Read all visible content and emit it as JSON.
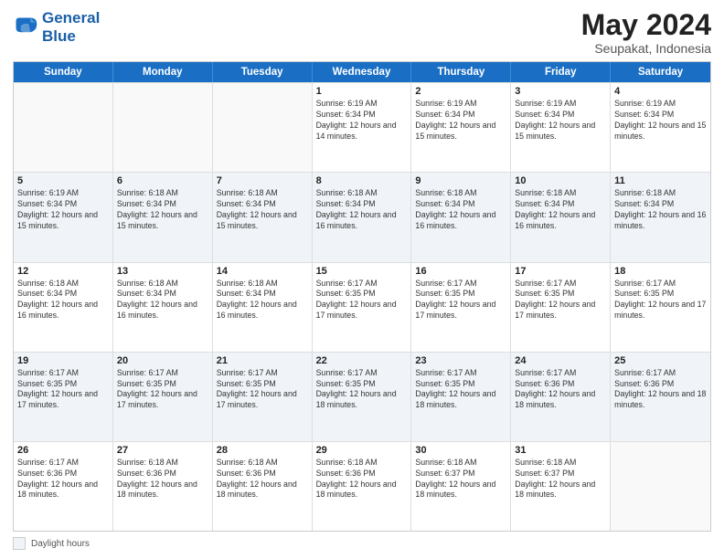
{
  "logo": {
    "line1": "General",
    "line2": "Blue"
  },
  "title": "May 2024",
  "subtitle": "Seupakat, Indonesia",
  "header_days": [
    "Sunday",
    "Monday",
    "Tuesday",
    "Wednesday",
    "Thursday",
    "Friday",
    "Saturday"
  ],
  "footer": {
    "swatch_label": "Daylight hours"
  },
  "rows": [
    [
      {
        "day": "",
        "sunrise": "",
        "sunset": "",
        "daylight": "",
        "empty": true
      },
      {
        "day": "",
        "sunrise": "",
        "sunset": "",
        "daylight": "",
        "empty": true
      },
      {
        "day": "",
        "sunrise": "",
        "sunset": "",
        "daylight": "",
        "empty": true
      },
      {
        "day": "1",
        "sunrise": "Sunrise: 6:19 AM",
        "sunset": "Sunset: 6:34 PM",
        "daylight": "Daylight: 12 hours and 14 minutes.",
        "empty": false
      },
      {
        "day": "2",
        "sunrise": "Sunrise: 6:19 AM",
        "sunset": "Sunset: 6:34 PM",
        "daylight": "Daylight: 12 hours and 15 minutes.",
        "empty": false
      },
      {
        "day": "3",
        "sunrise": "Sunrise: 6:19 AM",
        "sunset": "Sunset: 6:34 PM",
        "daylight": "Daylight: 12 hours and 15 minutes.",
        "empty": false
      },
      {
        "day": "4",
        "sunrise": "Sunrise: 6:19 AM",
        "sunset": "Sunset: 6:34 PM",
        "daylight": "Daylight: 12 hours and 15 minutes.",
        "empty": false
      }
    ],
    [
      {
        "day": "5",
        "sunrise": "Sunrise: 6:19 AM",
        "sunset": "Sunset: 6:34 PM",
        "daylight": "Daylight: 12 hours and 15 minutes.",
        "empty": false
      },
      {
        "day": "6",
        "sunrise": "Sunrise: 6:18 AM",
        "sunset": "Sunset: 6:34 PM",
        "daylight": "Daylight: 12 hours and 15 minutes.",
        "empty": false
      },
      {
        "day": "7",
        "sunrise": "Sunrise: 6:18 AM",
        "sunset": "Sunset: 6:34 PM",
        "daylight": "Daylight: 12 hours and 15 minutes.",
        "empty": false
      },
      {
        "day": "8",
        "sunrise": "Sunrise: 6:18 AM",
        "sunset": "Sunset: 6:34 PM",
        "daylight": "Daylight: 12 hours and 16 minutes.",
        "empty": false
      },
      {
        "day": "9",
        "sunrise": "Sunrise: 6:18 AM",
        "sunset": "Sunset: 6:34 PM",
        "daylight": "Daylight: 12 hours and 16 minutes.",
        "empty": false
      },
      {
        "day": "10",
        "sunrise": "Sunrise: 6:18 AM",
        "sunset": "Sunset: 6:34 PM",
        "daylight": "Daylight: 12 hours and 16 minutes.",
        "empty": false
      },
      {
        "day": "11",
        "sunrise": "Sunrise: 6:18 AM",
        "sunset": "Sunset: 6:34 PM",
        "daylight": "Daylight: 12 hours and 16 minutes.",
        "empty": false
      }
    ],
    [
      {
        "day": "12",
        "sunrise": "Sunrise: 6:18 AM",
        "sunset": "Sunset: 6:34 PM",
        "daylight": "Daylight: 12 hours and 16 minutes.",
        "empty": false
      },
      {
        "day": "13",
        "sunrise": "Sunrise: 6:18 AM",
        "sunset": "Sunset: 6:34 PM",
        "daylight": "Daylight: 12 hours and 16 minutes.",
        "empty": false
      },
      {
        "day": "14",
        "sunrise": "Sunrise: 6:18 AM",
        "sunset": "Sunset: 6:34 PM",
        "daylight": "Daylight: 12 hours and 16 minutes.",
        "empty": false
      },
      {
        "day": "15",
        "sunrise": "Sunrise: 6:17 AM",
        "sunset": "Sunset: 6:35 PM",
        "daylight": "Daylight: 12 hours and 17 minutes.",
        "empty": false
      },
      {
        "day": "16",
        "sunrise": "Sunrise: 6:17 AM",
        "sunset": "Sunset: 6:35 PM",
        "daylight": "Daylight: 12 hours and 17 minutes.",
        "empty": false
      },
      {
        "day": "17",
        "sunrise": "Sunrise: 6:17 AM",
        "sunset": "Sunset: 6:35 PM",
        "daylight": "Daylight: 12 hours and 17 minutes.",
        "empty": false
      },
      {
        "day": "18",
        "sunrise": "Sunrise: 6:17 AM",
        "sunset": "Sunset: 6:35 PM",
        "daylight": "Daylight: 12 hours and 17 minutes.",
        "empty": false
      }
    ],
    [
      {
        "day": "19",
        "sunrise": "Sunrise: 6:17 AM",
        "sunset": "Sunset: 6:35 PM",
        "daylight": "Daylight: 12 hours and 17 minutes.",
        "empty": false
      },
      {
        "day": "20",
        "sunrise": "Sunrise: 6:17 AM",
        "sunset": "Sunset: 6:35 PM",
        "daylight": "Daylight: 12 hours and 17 minutes.",
        "empty": false
      },
      {
        "day": "21",
        "sunrise": "Sunrise: 6:17 AM",
        "sunset": "Sunset: 6:35 PM",
        "daylight": "Daylight: 12 hours and 17 minutes.",
        "empty": false
      },
      {
        "day": "22",
        "sunrise": "Sunrise: 6:17 AM",
        "sunset": "Sunset: 6:35 PM",
        "daylight": "Daylight: 12 hours and 18 minutes.",
        "empty": false
      },
      {
        "day": "23",
        "sunrise": "Sunrise: 6:17 AM",
        "sunset": "Sunset: 6:35 PM",
        "daylight": "Daylight: 12 hours and 18 minutes.",
        "empty": false
      },
      {
        "day": "24",
        "sunrise": "Sunrise: 6:17 AM",
        "sunset": "Sunset: 6:36 PM",
        "daylight": "Daylight: 12 hours and 18 minutes.",
        "empty": false
      },
      {
        "day": "25",
        "sunrise": "Sunrise: 6:17 AM",
        "sunset": "Sunset: 6:36 PM",
        "daylight": "Daylight: 12 hours and 18 minutes.",
        "empty": false
      }
    ],
    [
      {
        "day": "26",
        "sunrise": "Sunrise: 6:17 AM",
        "sunset": "Sunset: 6:36 PM",
        "daylight": "Daylight: 12 hours and 18 minutes.",
        "empty": false
      },
      {
        "day": "27",
        "sunrise": "Sunrise: 6:18 AM",
        "sunset": "Sunset: 6:36 PM",
        "daylight": "Daylight: 12 hours and 18 minutes.",
        "empty": false
      },
      {
        "day": "28",
        "sunrise": "Sunrise: 6:18 AM",
        "sunset": "Sunset: 6:36 PM",
        "daylight": "Daylight: 12 hours and 18 minutes.",
        "empty": false
      },
      {
        "day": "29",
        "sunrise": "Sunrise: 6:18 AM",
        "sunset": "Sunset: 6:36 PM",
        "daylight": "Daylight: 12 hours and 18 minutes.",
        "empty": false
      },
      {
        "day": "30",
        "sunrise": "Sunrise: 6:18 AM",
        "sunset": "Sunset: 6:37 PM",
        "daylight": "Daylight: 12 hours and 18 minutes.",
        "empty": false
      },
      {
        "day": "31",
        "sunrise": "Sunrise: 6:18 AM",
        "sunset": "Sunset: 6:37 PM",
        "daylight": "Daylight: 12 hours and 18 minutes.",
        "empty": false
      },
      {
        "day": "",
        "sunrise": "",
        "sunset": "",
        "daylight": "",
        "empty": true
      }
    ]
  ]
}
